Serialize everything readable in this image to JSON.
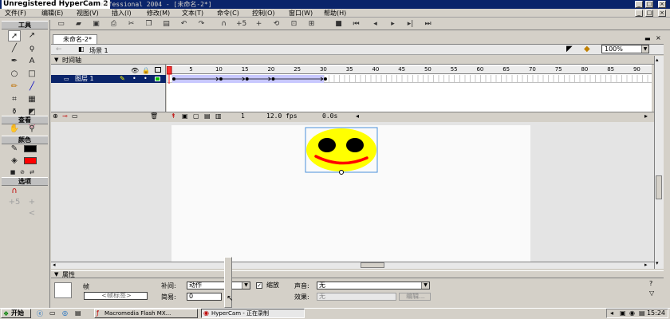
{
  "window": {
    "capture_title": "Unregistered HyperCam 2",
    "app_title": "rofessional 2004 - [未命名-2*]"
  },
  "menu": [
    "文件(F)",
    "编辑(E)",
    "视图(V)",
    "插入(I)",
    "修改(M)",
    "文本(T)",
    "命令(C)",
    "控制(O)",
    "窗口(W)",
    "帮助(H)"
  ],
  "tools": {
    "header": "工具",
    "view_header": "查看",
    "colors_header": "颜色",
    "options_header": "选项",
    "stroke_color": "#000000",
    "fill_color": "#ff0000"
  },
  "document": {
    "tab": "未命名-2*",
    "scene": "场景 1",
    "zoom": "100%"
  },
  "timeline": {
    "label": "时间轴",
    "layer_name": "图层 1",
    "ruler": [
      "1",
      "5",
      "10",
      "15",
      "20",
      "25",
      "30",
      "35",
      "40",
      "45",
      "50",
      "55",
      "60",
      "65",
      "70",
      "75",
      "80",
      "85",
      "90"
    ],
    "current_frame": "1",
    "fps": "12.0 fps",
    "time": "0.0s"
  },
  "properties": {
    "label": "属性",
    "type": "帧",
    "frame_label_placeholder": "<帧标签>",
    "tween_label": "补间:",
    "tween_value": "动作",
    "scale_label": "缩放",
    "ease_label": "简易:",
    "ease_value": "0",
    "sound_label": "声音:",
    "sound_value": "无",
    "effect_label": "效果:",
    "effect_value": "无",
    "edit_button": "编辑..."
  },
  "smiley": {
    "face_color": "#ffff00",
    "eye_color": "#000000",
    "mouth_color": "#ff0000"
  },
  "taskbar": {
    "start": "开始",
    "tasks": [
      "Macromedia Flash MX...",
      "HyperCam - 正在录制"
    ],
    "clock": "15:24"
  }
}
